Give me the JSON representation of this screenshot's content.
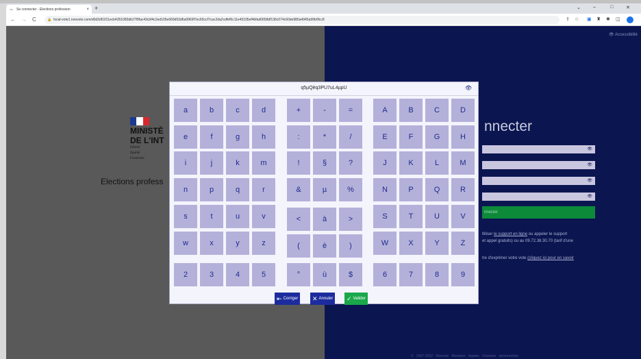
{
  "browser": {
    "tab_title": "Se connecter - Elections profession",
    "new_tab": "+",
    "tab_close": "×",
    "url": "local-vote1.neovote.com/d0d3d51f11ecb4351083db27f9fac43cbf4c2ed105e669d53d6a9969f7ec65ccf7cac2da2cdfef6c11e45195ef4bfad0658df136c074c60de980a4945a99b0fcc8",
    "nav": {
      "back": "←",
      "forward": "→",
      "reload": "C"
    },
    "window": {
      "chevron": "⌄",
      "minimize": "–",
      "maximize": "□",
      "close": "✕"
    },
    "icons": [
      "share-icon",
      "star-icon",
      "extension-icon",
      "puzzle-icon",
      "sidebar-icon",
      "profile-icon"
    ],
    "accent": "#1a73e8"
  },
  "page": {
    "accessibility": "Accessibilité",
    "ministry_line1": "MINISTÈ",
    "ministry_line2": "DE L'INT",
    "motto_1": "Liberté",
    "motto_2": "Égalité",
    "motto_3": "Fraternité",
    "elections": "Elections profess",
    "connect_title": "nnecter",
    "connect_button": "nnecter",
    "help1_pre": "ltiliser ",
    "help1_link": "le support en ligne",
    "help1_post": " ou appeler le support",
    "help2": "et appel gratuits) ou au 09.72.38.30.70 (tarif d'une",
    "help3_pre": "tre d'exprimer votre vote ",
    "help3_link": "(cliquez ici pour en savoir",
    "footer": "© 2007-2022 Neovote  Mentions légales  Données personnelles",
    "left_bg": "#595959",
    "right_bg": "#0b1550"
  },
  "keyboard": {
    "code": "q5µQèq3PU7uL4µpU",
    "eye": "👁",
    "key_color": "#b3b1da",
    "groups": [
      [
        "a",
        "b",
        "c",
        "d",
        "e",
        "f",
        "g",
        "h",
        "i",
        "j",
        "k",
        "m",
        "n",
        "p",
        "q",
        "r",
        "s",
        "t",
        "u",
        "v",
        "w",
        "x",
        "y",
        "z",
        "2",
        "3",
        "4",
        "5"
      ],
      [
        "+",
        "-",
        "=",
        ":",
        "*",
        "/",
        "!",
        "§",
        "?",
        "&",
        "µ",
        "%",
        "<",
        "à",
        ">",
        "(",
        "è",
        ")",
        "°",
        "ù",
        "$"
      ],
      [
        "A",
        "B",
        "C",
        "D",
        "E",
        "F",
        "G",
        "H",
        "J",
        "K",
        "L",
        "M",
        "N",
        "P",
        "Q",
        "R",
        "S",
        "T",
        "U",
        "V",
        "W",
        "X",
        "Y",
        "Z",
        "6",
        "7",
        "8",
        "9"
      ]
    ],
    "actions": {
      "correct": "Corriger",
      "cancel": "Annuler",
      "validate": "Valider",
      "correct_color": "#1c2c9e",
      "cancel_color": "#1c2c9e",
      "validate_color": "#19a84a"
    }
  }
}
